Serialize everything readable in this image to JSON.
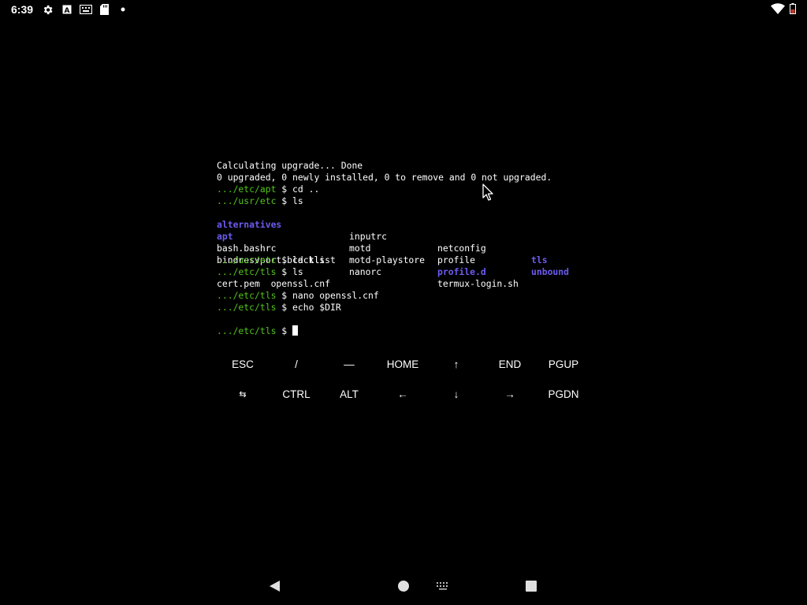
{
  "status_bar": {
    "time": "6:39",
    "left_icons": [
      "settings-icon",
      "a-icon",
      "keyboard-icon",
      "sd-card-icon",
      "dot-icon"
    ],
    "right_icons": [
      "wifi-icon",
      "battery-icon"
    ]
  },
  "terminal": {
    "line1": "Calculating upgrade... Done",
    "line2": "0 upgraded, 0 newly installed, 0 to remove and 0 not upgraded.",
    "p_apt": ".../etc/apt",
    "p_usretc": ".../usr/etc",
    "p_tls": ".../etc/tls",
    "dollar": " $ ",
    "cmd_cd_up": "cd ..",
    "cmd_ls": "ls",
    "cmd_cd_tls": "cd tls",
    "cmd_nano": "nano openssl.cnf",
    "cmd_echo": "echo $DIR",
    "ls1": {
      "r1c1": "alternatives",
      "r1c2": "inputrc",
      "r1c3": "netconfig",
      "r1c4": "tls",
      "r2c1": "apt",
      "r2c2": "motd",
      "r2c3": "profile",
      "r2c4": "unbound",
      "r3c1": "bash.bashrc",
      "r3c2": "motd-playstore",
      "r3c3": "profile.d",
      "r4c1": "bindresvport.blacklist",
      "r4c2": "nanorc",
      "r4c3": "termux-login.sh"
    },
    "ls2": "cert.pem  openssl.cnf"
  },
  "extra_keys": {
    "row1": [
      "ESC",
      "/",
      "—",
      "HOME",
      "↑",
      "END",
      "PGUP"
    ],
    "row2": [
      "⇆",
      "CTRL",
      "ALT",
      "←",
      "↓",
      "→",
      "PGDN"
    ]
  },
  "nav_icons": [
    "back-icon",
    "home-icon",
    "keyboard-switch-icon",
    "recents-icon"
  ]
}
